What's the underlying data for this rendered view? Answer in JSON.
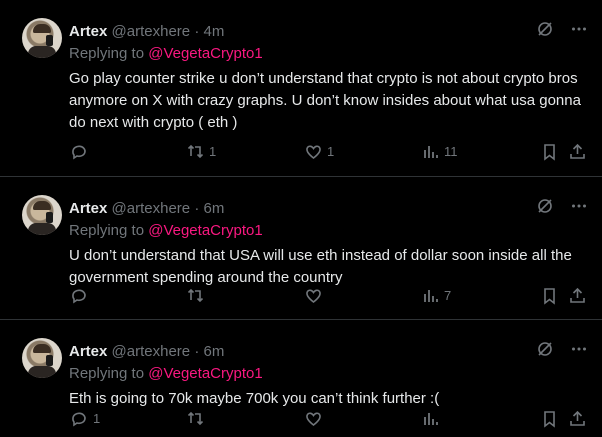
{
  "tweets": [
    {
      "name": "Artex",
      "handle": "@artexhere",
      "dot": "·",
      "time": "4m",
      "replying_prefix": "Replying to ",
      "replying_to": "@VegetaCrypto1",
      "text": "Go play counter strike u don’t understand that crypto is not about crypto bros anymore on X with crazy graphs. U don’t know insides about what usa gonna do next with crypto ( eth )",
      "replies": "",
      "retweets": "1",
      "likes": "1",
      "views": "11"
    },
    {
      "name": "Artex",
      "handle": "@artexhere",
      "dot": "·",
      "time": "6m",
      "replying_prefix": "Replying to ",
      "replying_to": "@VegetaCrypto1",
      "text": "U don’t understand that USA will use eth instead of dollar soon inside all the government spending around the country",
      "replies": "",
      "retweets": "",
      "likes": "",
      "views": "7"
    },
    {
      "name": "Artex",
      "handle": "@artexhere",
      "dot": "·",
      "time": "6m",
      "replying_prefix": "Replying to ",
      "replying_to": "@VegetaCrypto1",
      "text": "Eth is going to 70k maybe 700k you can’t think further  :(",
      "replies": "1",
      "retweets": "",
      "likes": "",
      "views": ""
    }
  ],
  "icons": {
    "grok": "grok-icon",
    "more": "more-icon",
    "reply": "reply-icon",
    "retweet": "retweet-icon",
    "like": "like-icon",
    "views": "views-icon",
    "bookmark": "bookmark-icon",
    "share": "share-icon"
  },
  "colors": {
    "background": "#000000",
    "text": "#e7e9ea",
    "muted": "#71767b",
    "mention": "#f91880",
    "border": "#2f3336"
  }
}
